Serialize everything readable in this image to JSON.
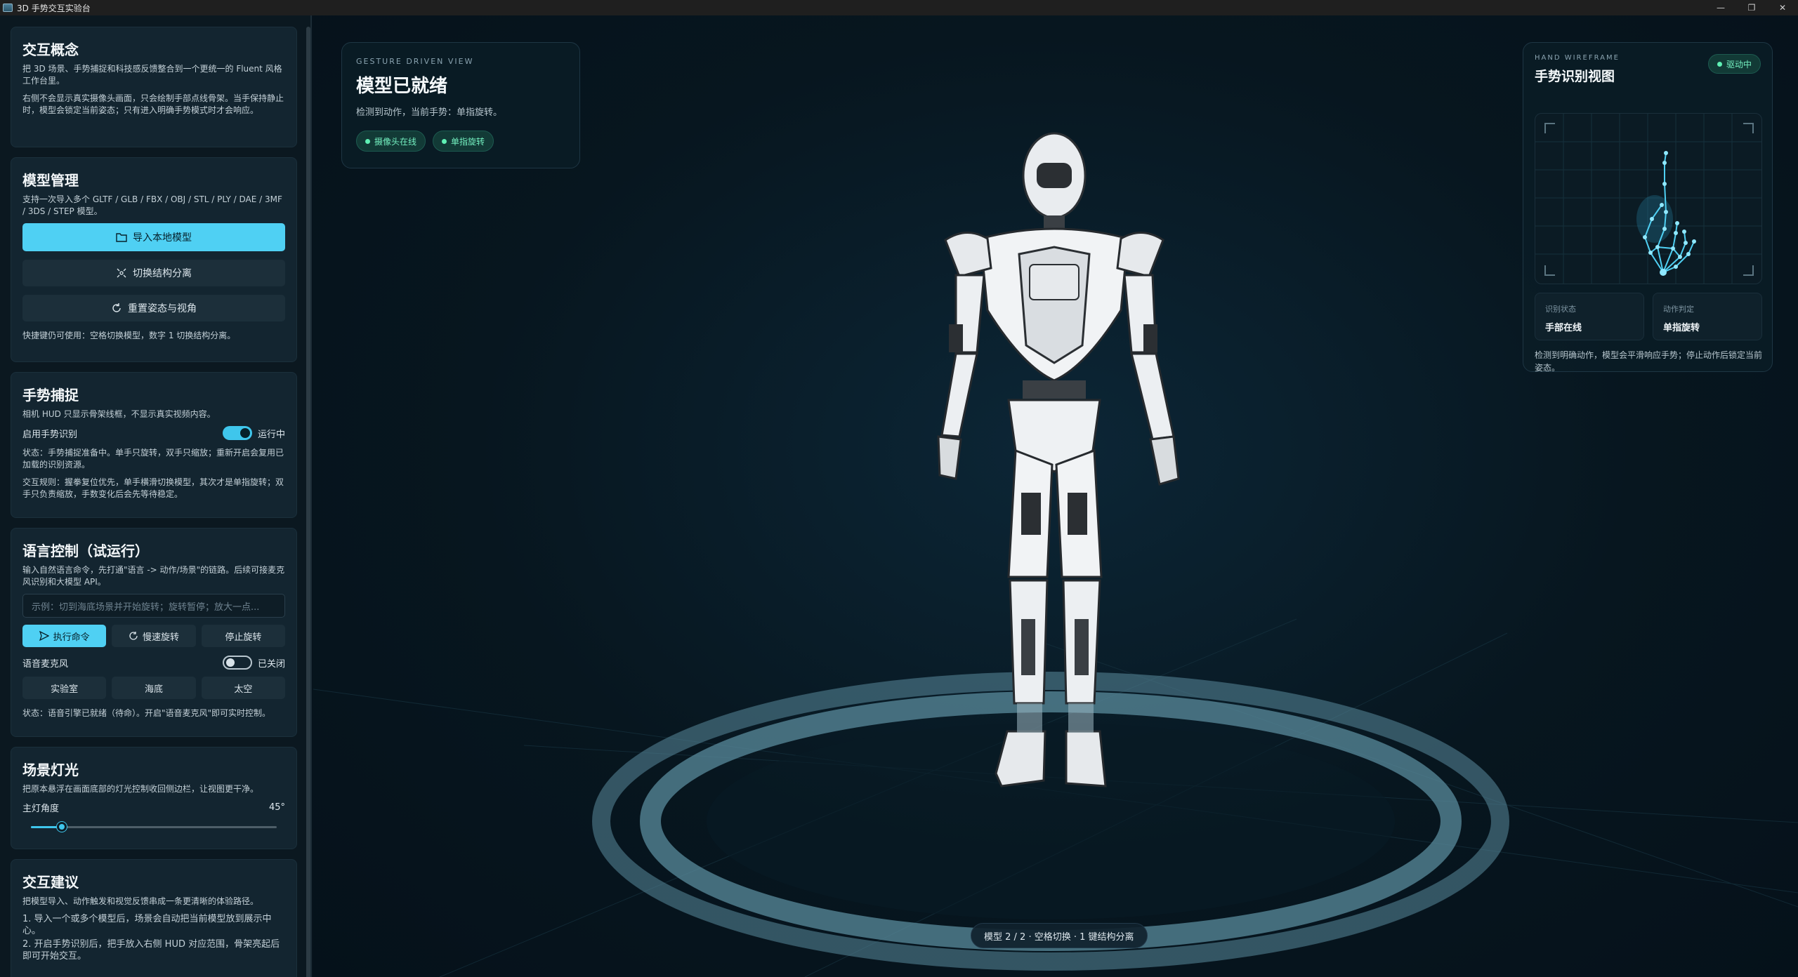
{
  "window": {
    "title": "3D 手势交互实验台",
    "controls": [
      "—",
      "❐",
      "✕"
    ]
  },
  "sidebar": {
    "concept": {
      "title": "交互概念",
      "p1": "把 3D 场景、手势捕捉和科技感反馈整合到一个更统一的 Fluent 风格工作台里。",
      "p2": "右侧不会显示真实摄像头画面，只会绘制手部点线骨架。当手保持静止时，模型会锁定当前姿态；只有进入明确手势模式时才会响应。"
    },
    "models": {
      "title": "模型管理",
      "desc": "支持一次导入多个 GLTF / GLB / FBX / OBJ / STL / PLY / DAE / 3MF / 3DS / STEP 模型。",
      "import_label": "导入本地模型",
      "toggle_label": "切换结构分离",
      "reset_label": "重置姿态与视角",
      "hint": "快捷键仍可使用：空格切换模型，数字 1 切换结构分离。"
    },
    "gesture": {
      "title": "手势捕捉",
      "desc": "相机 HUD 只显示骨架线框，不显示真实视频内容。",
      "enable_label": "启用手势识别",
      "enable_state": "运行中",
      "status": "状态：手势捕捉准备中。单手只旋转，双手只缩放；重新开启会复用已加载的识别资源。",
      "rules": "交互规则：握拳复位优先，单手横滑切换模型，其次才是单指旋转；双手只负责缩放，手数变化后会先等待稳定。"
    },
    "voice": {
      "title": "语言控制（试运行）",
      "desc": "输入自然语言命令，先打通\"语言 -> 动作/场景\"的链路。后续可接麦克风识别和大模型 API。",
      "placeholder": "示例：切到海底场景并开始旋转；旋转暂停；放大一点...",
      "execute_label": "执行命令",
      "slow_label": "慢速旋转",
      "stop_label": "停止旋转",
      "mic_label": "语音麦克风",
      "mic_state": "已关闭",
      "scene_lab": "实验室",
      "scene_sea": "海底",
      "scene_space": "太空",
      "status": "状态：语音引擎已就绪（待命）。开启\"语音麦克风\"即可实时控制。"
    },
    "lighting": {
      "title": "场景灯光",
      "desc": "把原本悬浮在画面底部的灯光控制收回侧边栏，让视图更干净。",
      "angle_label": "主灯角度",
      "angle_value": "45°",
      "angle_fraction": 0.125
    },
    "tips": {
      "title": "交互建议",
      "desc": "把模型导入、动作触发和视觉反馈串成一条更清晰的体验路径。",
      "item1": "1. 导入一个或多个模型后，场景会自动把当前模型放到展示中心。",
      "item2": "2. 开启手势识别后，把手放入右侧 HUD 对应范围，骨架亮起后即可开始交互。"
    }
  },
  "status_card": {
    "eyebrow": "GESTURE DRIVEN VIEW",
    "title": "模型已就绪",
    "subtitle": "检测到动作，当前手势：单指旋转。",
    "pill_camera": "摄像头在线",
    "pill_gesture": "单指旋转"
  },
  "hud": {
    "eyebrow": "HAND WIREFRAME",
    "title": "手势识别视图",
    "badge": "驱动中",
    "k1": "识别状态",
    "v1": "手部在线",
    "k2": "动作判定",
    "v2": "单指旋转",
    "note": "检测到明确动作，模型会平滑响应手势；停止动作后锁定当前姿态。"
  },
  "bottom_status": "模型 2 / 2 · 空格切换 · 1 键结构分离",
  "colors": {
    "accent": "#4fd0f3",
    "success": "#5ff0b4",
    "bg": "#06131c",
    "ring": "#4a7f92"
  }
}
